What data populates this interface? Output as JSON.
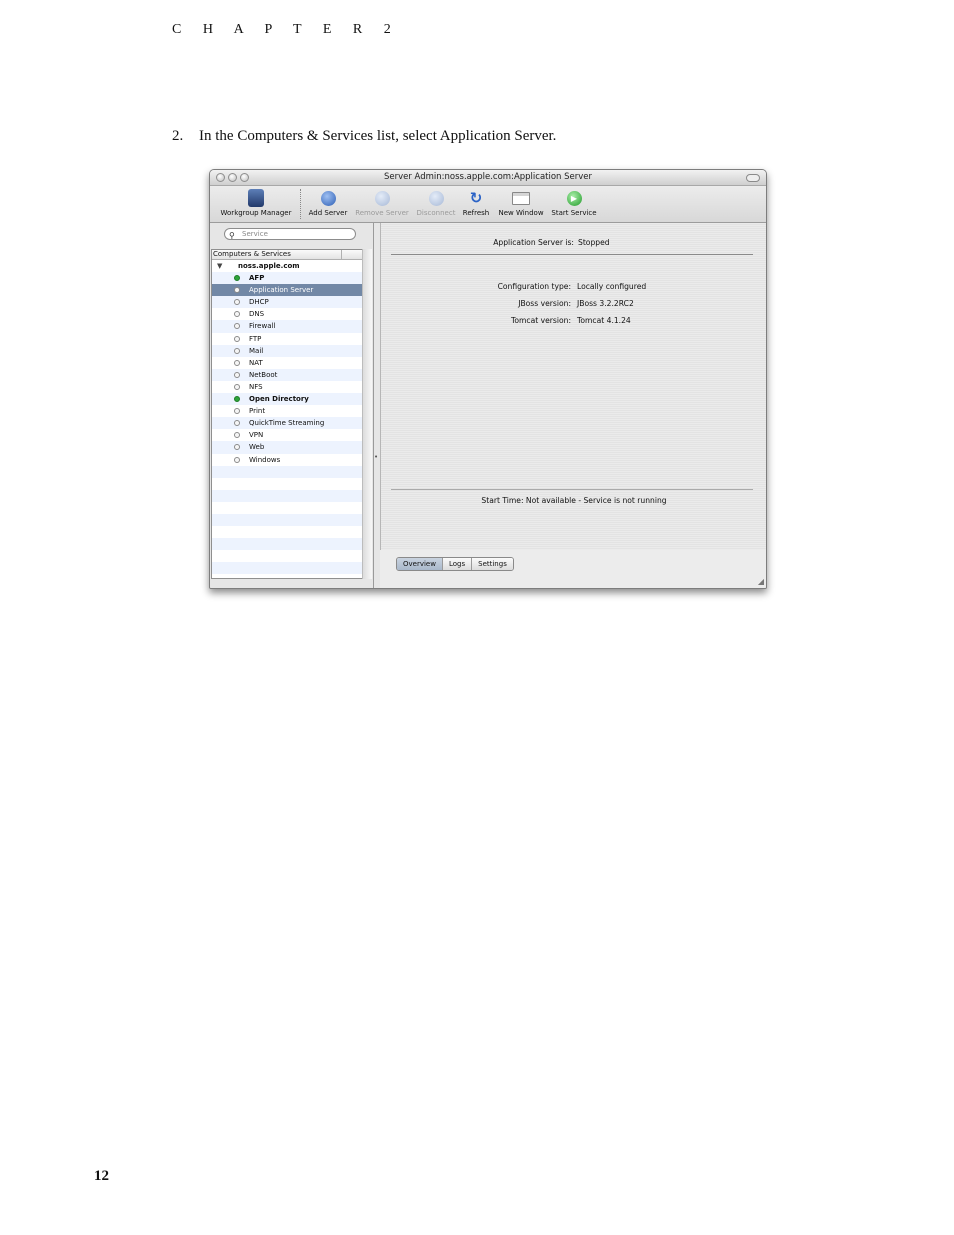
{
  "header": {
    "chapter": "C H A P T E R  2"
  },
  "instruction": {
    "number": "2.",
    "text": "In the Computers & Services list, select Application Server."
  },
  "page_number": "12",
  "window": {
    "title": "Server Admin:noss.apple.com:Application Server",
    "toolbar": [
      {
        "label": "Workgroup Manager",
        "icon": "workgroup-manager-icon",
        "enabled": true
      },
      {
        "label": "Add Server",
        "icon": "add-server-icon",
        "enabled": true
      },
      {
        "label": "Remove Server",
        "icon": "remove-server-icon",
        "enabled": false
      },
      {
        "label": "Disconnect",
        "icon": "disconnect-icon",
        "enabled": false
      },
      {
        "label": "Refresh",
        "icon": "refresh-icon",
        "enabled": true
      },
      {
        "label": "New Window",
        "icon": "new-window-icon",
        "enabled": true
      },
      {
        "label": "Start Service",
        "icon": "start-service-icon",
        "enabled": true
      }
    ],
    "search": {
      "placeholder": "Service"
    },
    "list": {
      "header": "Computers & Services",
      "host": "noss.apple.com",
      "services": [
        {
          "name": "AFP",
          "running": true
        },
        {
          "name": "Application Server",
          "running": false,
          "selected": true
        },
        {
          "name": "DHCP",
          "running": false
        },
        {
          "name": "DNS",
          "running": false
        },
        {
          "name": "Firewall",
          "running": false
        },
        {
          "name": "FTP",
          "running": false
        },
        {
          "name": "Mail",
          "running": false
        },
        {
          "name": "NAT",
          "running": false
        },
        {
          "name": "NetBoot",
          "running": false
        },
        {
          "name": "NFS",
          "running": false
        },
        {
          "name": "Open Directory",
          "running": true
        },
        {
          "name": "Print",
          "running": false
        },
        {
          "name": "QuickTime Streaming",
          "running": false
        },
        {
          "name": "VPN",
          "running": false
        },
        {
          "name": "Web",
          "running": false
        },
        {
          "name": "Windows",
          "running": false
        }
      ]
    },
    "overview": {
      "status_label": "Application Server is:",
      "status_value": "Stopped",
      "config_label": "Configuration type:",
      "config_value": "Locally configured",
      "jboss_label": "JBoss version:",
      "jboss_value": "JBoss 3.2.2RC2",
      "tomcat_label": "Tomcat version:",
      "tomcat_value": "Tomcat 4.1.24",
      "start_time_label": "Start Time:",
      "start_time_value": "Not available - Service is not running"
    },
    "tabs": [
      "Overview",
      "Logs",
      "Settings"
    ]
  }
}
